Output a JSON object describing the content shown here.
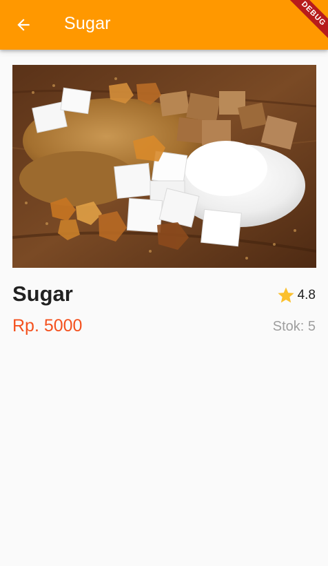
{
  "appbar": {
    "title": "Sugar",
    "back_icon": "arrow-back-icon",
    "color": "#ff9800",
    "debug_banner": "DEBUG"
  },
  "product": {
    "image_alt": "sugar",
    "name": "Sugar",
    "rating": "4.8",
    "rating_icon": "star-icon",
    "price": "Rp. 5000",
    "stock": "Stok: 5"
  },
  "colors": {
    "price": "#f4511e",
    "star": "#fbc02d",
    "stock": "#9e9e9e"
  }
}
